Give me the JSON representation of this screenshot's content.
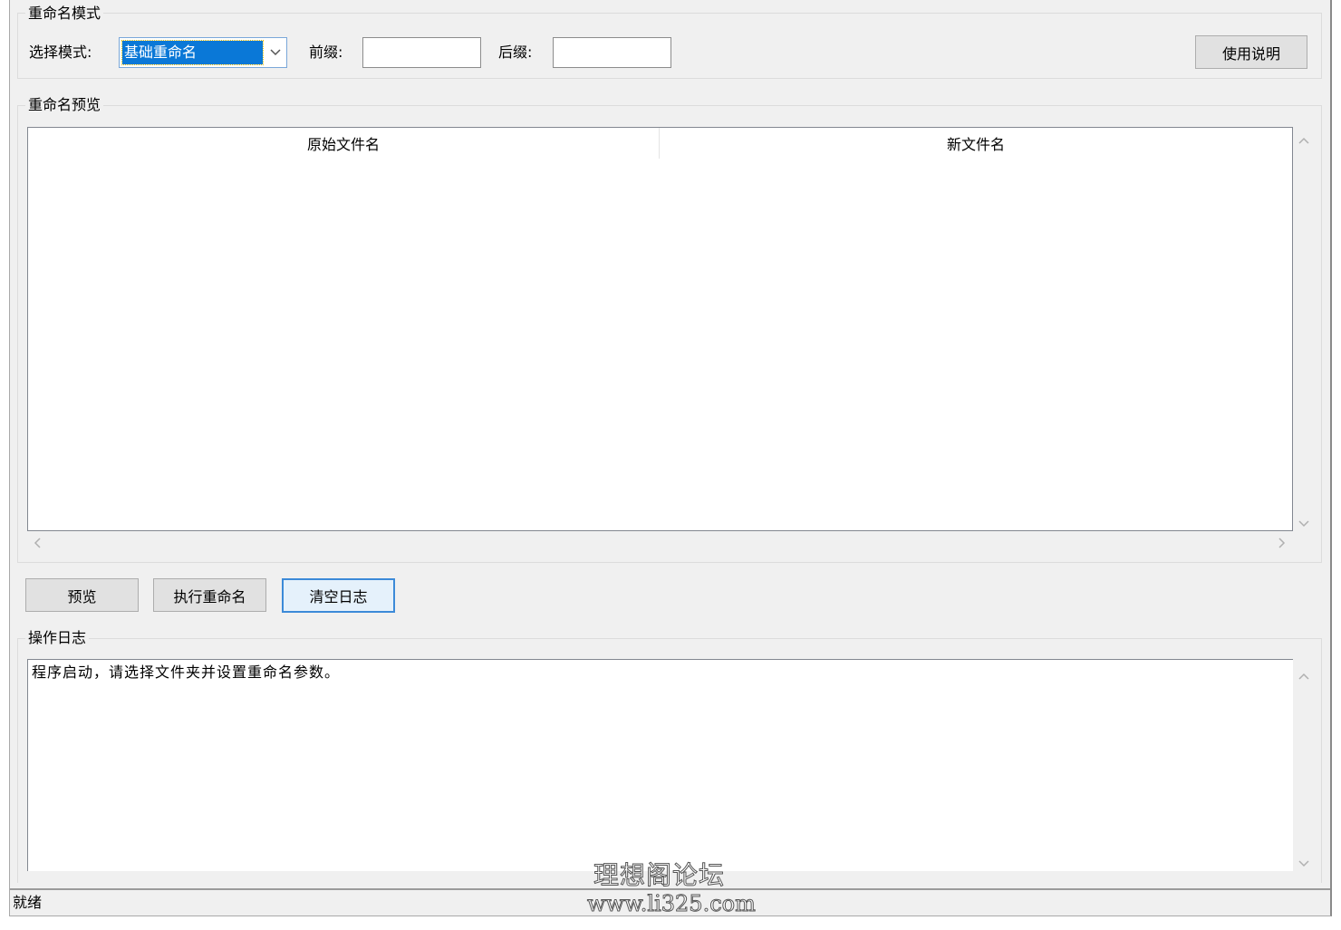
{
  "mode_group": {
    "title": "重命名模式",
    "select_mode_label": "选择模式:",
    "mode_value": "基础重命名",
    "prefix_label": "前缀:",
    "prefix_value": "",
    "suffix_label": "后缀:",
    "suffix_value": "",
    "help_button": "使用说明"
  },
  "preview_group": {
    "title": "重命名预览",
    "columns": [
      "原始文件名",
      "新文件名"
    ],
    "rows": []
  },
  "actions": {
    "preview_button": "预览",
    "execute_button": "执行重命名",
    "clear_log_button": "清空日志"
  },
  "log_group": {
    "title": "操作日志",
    "text": "程序启动，请选择文件夹并设置重命名参数。"
  },
  "status": {
    "text": "就绪"
  },
  "watermark": {
    "line1": "理想阁论坛",
    "line2": "www.li325.com"
  },
  "icons": {
    "combo_arrow": "chevron-down-icon",
    "scroll_up": "chevron-up-icon",
    "scroll_down": "chevron-down-icon",
    "scroll_left": "chevron-left-icon",
    "scroll_right": "chevron-right-icon"
  },
  "colors": {
    "selection": "#0a78d7",
    "focus_border": "#3c8ad8",
    "window_bg": "#f0f0f0"
  }
}
